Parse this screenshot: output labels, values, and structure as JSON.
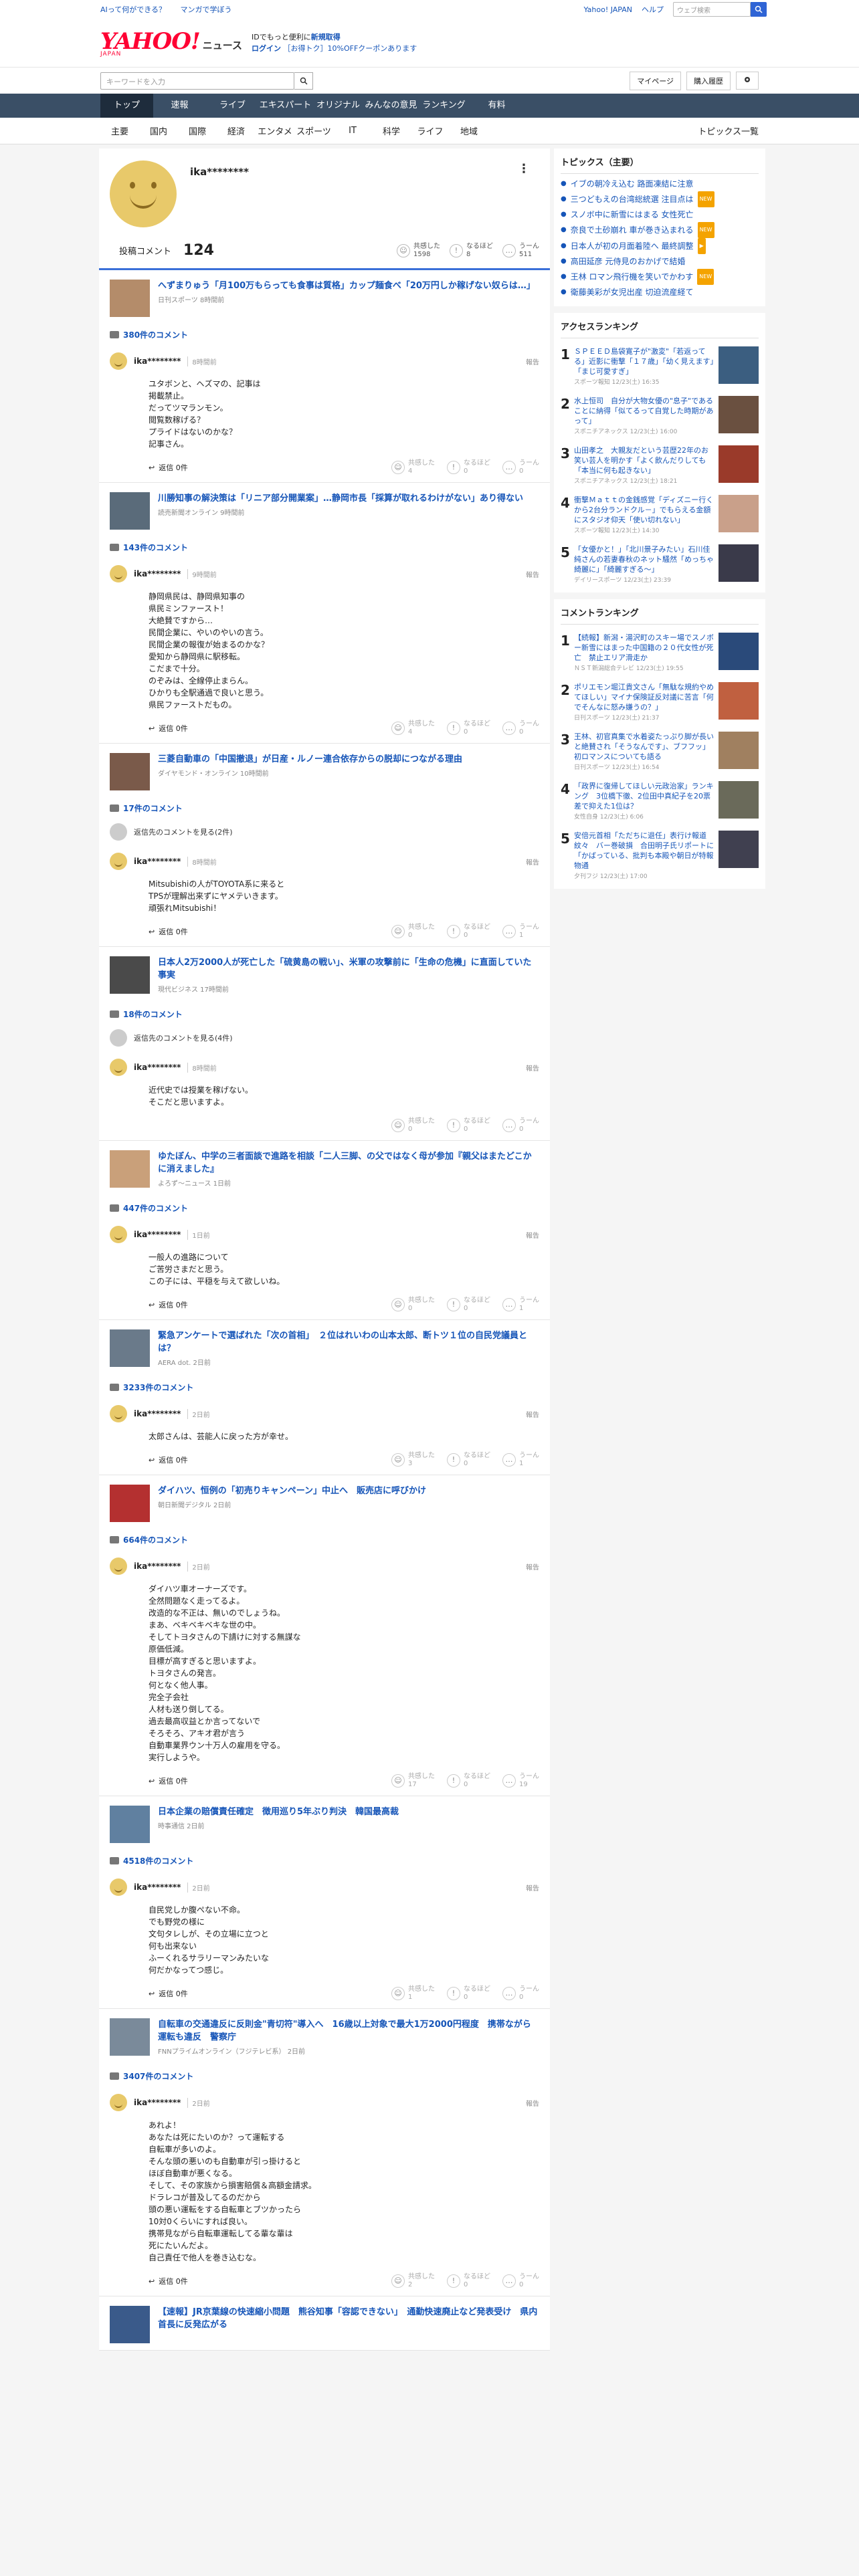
{
  "topbar": {
    "left1": "AIって何ができる？",
    "left2": "マンガで学ぼう",
    "right1": "Yahoo! JAPAN",
    "right2": "ヘルプ",
    "search_placeholder": "ウェブ検索"
  },
  "header": {
    "logo": "YAHOO!",
    "logo_jp": "JAPAN",
    "logo_sub": "ニュース",
    "promo1a": "IDでもっと便利に",
    "promo1b": "新規取得",
    "promo2a": "ログイン",
    "promo2b": "［お得トク］10%OFFクーポンあります"
  },
  "searchrow": {
    "placeholder": "キーワードを入力",
    "mypage": "マイページ",
    "subscribe": "購入履歴"
  },
  "nav": [
    "トップ",
    "速報",
    "ライブ",
    "エキスパート",
    "オリジナル",
    "みんなの意見",
    "ランキング",
    "有料"
  ],
  "subnav": [
    "主要",
    "国内",
    "国際",
    "経済",
    "エンタメ",
    "スポーツ",
    "IT",
    "科学",
    "ライフ",
    "地域"
  ],
  "subnav_right": "トピックス一覧",
  "profile": {
    "name": "ika********",
    "comment_label": "投稿コメント",
    "comment_count": "124",
    "r1": "共感した",
    "r1n": "1598",
    "r2": "なるほど",
    "r2n": "8",
    "r3": "うーん",
    "r3n": "511"
  },
  "cards": [
    {
      "title": "へずまりゅう「月100万もらっても食事は質格」カップ麺食べ「20万円しか稼げない奴らは…」",
      "src": "日刊スポーツ 8時間前",
      "count": "380件のコメント",
      "name": "ika********",
      "time": "8時間前",
      "report": "報告",
      "body": "ユタボンと、ヘズマの、記事は\n掲載禁止。\nだってツマランモン。\n閲覧数稼げる？\nプライドはないのかな？\n記事さん。",
      "reply": "返信 0件",
      "a": "共感した\n4",
      "b": "なるほど\n0",
      "c": "うーん\n0"
    },
    {
      "title": "川勝知事の解決策は「リニア部分開業案」…静岡市長「採算が取れるわけがない」あり得ない",
      "src": "読売新聞オンライン 9時間前",
      "count": "143件のコメント",
      "name": "ika********",
      "time": "9時間前",
      "report": "報告",
      "body": "静岡県民は、静岡県知事の\n県民ミンファースト！\n大絶賛ですから…\n民間企業に、やいのやいの言う。\n民間企業の報復が始まるのかな？\n愛知から静岡県に駅移転。\nこだまで十分。\nのぞみは、全線停止まらん。\nひかりも全駅通過で良いと思う。\n県民ファーストだもの。",
      "reply": "返信 0件",
      "a": "共感した\n4",
      "b": "なるほど\n0",
      "c": "うーん\n0"
    },
    {
      "title": "三菱自動車の「中国撤退」が日産・ルノー連合依存からの脱却につながる理由",
      "src": "ダイヤモンド・オンライン 10時間前",
      "count": "17件のコメント",
      "see": "返信先のコメントを見る(2件)",
      "name": "ika********",
      "time": "8時間前",
      "report": "報告",
      "body": "Mitsubishiの人がTOYOTA系に来ると\nTPSが理解出来ずにヤメテいきます。\n頑張れMitsubishi！",
      "reply": "返信 0件",
      "a": "共感した\n0",
      "b": "なるほど\n0",
      "c": "うーん\n1"
    },
    {
      "title": "日本人2万2000人が死亡した「硫黄島の戦い」、米軍の攻撃前に「生命の危機」に直面していた事実",
      "src": "現代ビジネス 17時間前",
      "count": "18件のコメント",
      "see": "返信先のコメントを見る(4件)",
      "name": "ika********",
      "time": "8時間前",
      "report": "報告",
      "body": "近代史では授業を稼げない。\nそこだと思いますよ。",
      "reply": "",
      "a": "共感した\n0",
      "b": "なるほど\n0",
      "c": "うーん\n0"
    },
    {
      "title": "ゆたぼん、中学の三者面談で進路を相談「二人三脚、の父ではなく母が参加『親父はまたどこかに消えました』",
      "src": "よろず～ニュース 1日前",
      "count": "447件のコメント",
      "name": "ika********",
      "time": "1日前",
      "report": "報告",
      "body": "一般人の進路について\nご苦労さまだと思う。\nこの子には、平穏を与えて欲しいね。",
      "reply": "返信 0件",
      "a": "共感した\n0",
      "b": "なるほど\n0",
      "c": "うーん\n1"
    },
    {
      "title": "緊急アンケートで選ばれた「次の首相」　２位はれいわの山本太郎、断トツ１位の自民党議員とは？",
      "src": "AERA dot. 2日前",
      "count": "3233件のコメント",
      "name": "ika********",
      "time": "2日前",
      "report": "報告",
      "body": "太郎さんは、芸能人に戻った方が幸せ。",
      "reply": "返信 0件",
      "a": "共感した\n3",
      "b": "なるほど\n0",
      "c": "うーん\n1"
    },
    {
      "title": "ダイハツ、恒例の「初売りキャンペーン」中止へ　販売店に呼びかけ",
      "src": "朝日新聞デジタル 2日前",
      "count": "664件のコメント",
      "name": "ika********",
      "time": "2日前",
      "report": "報告",
      "body": "ダイハツ車オーナーズです。\n全然問題なく走ってるよ。\n改造的な不正は、無いのでしょうね。\nまあ、ベキベキベキな世の中。\nそしてトヨタさんの下請けに対する無謀な\n原価低減。\n目標が高すぎると思いますよ。\nトヨタさんの発言。\n何となく他人事。\n完全子会社\n人材も送り倒してる。\n過去最高収益とか言ってないで\nそろそろ、アキオ君が言う\n自動車業界ウン十万人の雇用を守る。\n実行しようや。",
      "reply": "返信 0件",
      "a": "共感した\n17",
      "b": "なるほど\n0",
      "c": "うーん\n19"
    },
    {
      "title": "日本企業の賠償責任確定　徴用巡り5年ぶり判決　韓国最高裁",
      "src": "時事通信 2日前",
      "count": "4518件のコメント",
      "name": "ika********",
      "time": "2日前",
      "report": "報告",
      "body": "自民党しか腹ぺない不命。\nでも野党の様に\n文句タレしが、その立場に立つと\n何も出来ない\nふーくれるサラリーマンみたいな\n何だかなってつ感じ。",
      "reply": "返信 0件",
      "a": "共感した\n1",
      "b": "なるほど\n0",
      "c": "うーん\n0"
    },
    {
      "title": "自転車の交通違反に反則金\"青切符\"導入へ　16歳以上対象で最大1万2000円程度　携帯ながら運転も違反　警察庁",
      "src": "FNNプライムオンライン（フジテレビ系） 2日前",
      "count": "3407件のコメント",
      "name": "ika********",
      "time": "2日前",
      "report": "報告",
      "body": "あれよ！\nあなたは死にたいのか？って運転する\n自転車が多いのよ。\nそんな頭の悪いのも自動車が引っ掛けると\nほぼ自動車が悪くなる。\nそして、その家族から損害賠償＆高額金請求。\nドラレコが普及してるのだから\n頭の悪い運転をする自転車とブツかったら\n10対0くらいにすれば良い。\n携帯見ながら自転車運転してる輩な輩は\n死にたいんだよ。\n自己責任で他人を巻き込むな。",
      "reply": "返信 0件",
      "a": "共感した\n2",
      "b": "なるほど\n0",
      "c": "うーん\n0"
    },
    {
      "title": "【速報】JR京葉線の快速縮小問題　熊谷知事「容認できない」　通勤快速廃止など発表受け　県内首長に反発広がる",
      "src": "",
      "count": "",
      "name": "",
      "time": "",
      "report": "",
      "body": "",
      "reply": "",
      "a": "",
      "b": "",
      "c": ""
    }
  ],
  "side": {
    "topics_head": "トピックス（主要）",
    "topics": [
      {
        "t": "イブの朝冷え込む 路面凍結に注意",
        "b": ""
      },
      {
        "t": "三つどもえの台湾総統選 注目点は",
        "b": "NEW"
      },
      {
        "t": "スノボ中に新雪にはまる 女性死亡",
        "b": ""
      },
      {
        "t": "奈良で土砂崩れ 車が巻き込まれる",
        "b": "NEW"
      },
      {
        "t": "日本人が初の月面着陸へ 最終調整",
        "b": "▶"
      },
      {
        "t": "高田延彦 元侍見のおかげで結婚",
        "b": ""
      },
      {
        "t": "王林 ロマン飛行機を笑いでかわす",
        "b": "NEW"
      },
      {
        "t": "衛藤美彩が女児出産 切迫流産経て",
        "b": ""
      }
    ],
    "access_head": "アクセスランキング",
    "access": [
      {
        "t": "ＳＰＥＥＤ島袋寛子が\"激変\"「若返ってる」近影に衝撃「１７歳」「幼く見えます」「まじ可愛すぎ」",
        "s": "スポーツ報知 12/23(土) 16:35"
      },
      {
        "t": "水上恒司　自分が大物女優の\"息子\"であることに納得「似てるって自覚した時期があって」",
        "s": "スポニチアネックス 12/23(土) 16:00"
      },
      {
        "t": "山田孝之　大親友だという芸歴22年のお笑い芸人を明かす「よく飲んだりしても「本当に何も起きない」",
        "s": "スポニチアネックス 12/23(土) 18:21"
      },
      {
        "t": "衝撃Ｍａｔｔの金銭感覚「ディズニー行くから2台分ランドクル－」でもらえる金額にスタジオ仰天「使い切れない」",
        "s": "スポーツ報知 12/23(土) 14:30"
      },
      {
        "t": "「女優かと！」「北川景子みたい」石川佳純さんの若妻春秋のネット騒然「めっちゃ綺麗に」「綺麗すぎる～」",
        "s": "デイリースポーツ 12/23(土) 23:39"
      }
    ],
    "comment_head": "コメントランキング",
    "comments": [
      {
        "t": "【続報】新潟・湯沢町のスキー場でスノボー新雪にはまった中国籍の２０代女性が死亡　禁止エリア滑走か",
        "s": "ＮＳＴ新潟総合テレビ 12/23(土) 19:55"
      },
      {
        "t": "ポリエモン堀江貴文さん「無駄な規約やめてほしい」マイナ保険証反対議に苦言「何でそんなに怒み嫌うの？」",
        "s": "日刊スポーツ 12/23(土) 21:37"
      },
      {
        "t": "王林、初官真集で水着姿たっぷり脚が長いと絶賛され「そうなんです」、ブフフッ」初ロマンスについても語る",
        "s": "日刊スポーツ 12/23(土) 16:54"
      },
      {
        "t": "「政界に復帰してほしい元政治家」ランキング　3位橋下徹、2位田中真紀子を20票差で抑えた1位は？",
        "s": "女性自身 12/23(土) 6:06"
      },
      {
        "t": "安倍元首相「ただちに退任」表行け報道紋々　バー巻破損　合田明子氏リポートに「かばっている、批判も本殿や朝日が特報物通",
        "s": "夕刊フジ 12/23(土) 17:00"
      }
    ]
  },
  "colors": {
    "accent": "#3a6fd8",
    "nav": "#3a4f66",
    "link": "#1655b8",
    "brand": "#ff0033"
  }
}
